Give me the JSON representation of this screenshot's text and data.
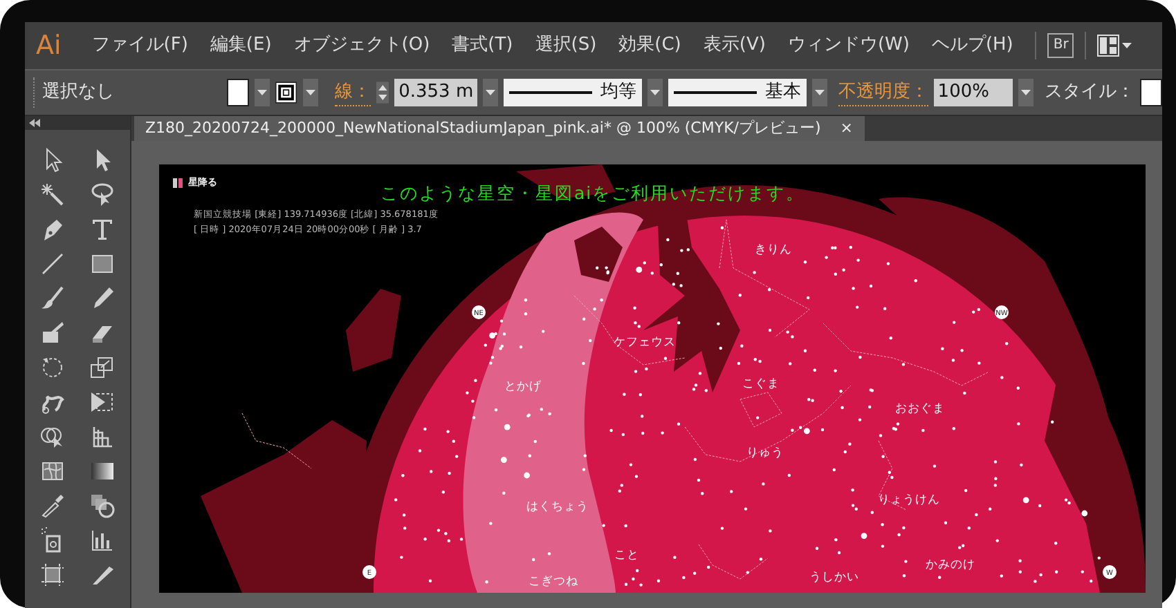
{
  "app": {
    "logo": "Ai",
    "menu": [
      "ファイル(F)",
      "編集(E)",
      "オブジェクト(O)",
      "書式(T)",
      "選択(S)",
      "効果(C)",
      "表示(V)",
      "ウィンドウ(W)",
      "ヘルプ(H)"
    ],
    "bridge_button": "Br"
  },
  "control_bar": {
    "selection": "選択なし",
    "stroke_label": "線：",
    "stroke_weight": "0.353 m",
    "profile": "均等",
    "brush": "基本",
    "opacity_label": "不透明度：",
    "opacity": "100%",
    "style_label": "スタイル："
  },
  "document_tab": {
    "title": "Z180_20200724_200000_NewNationalStadiumJapan_pink.ai* @ 100% (CMYK/プレビュー)",
    "close": "×"
  },
  "artboard": {
    "logo_text": "星降る",
    "banner": "このような星空・星図aiをご利用いただけます。",
    "info_lines": [
      "新国立競技場 [東経] 139.714936度 [北緯] 35.678181度",
      "[ 日時 ] 2020年07月24日 20時00分00秒 [ 月齢 ] 3.7"
    ],
    "chart_labels": [
      "きりん",
      "ケフェウス",
      "とかげ",
      "こぐま",
      "おおぐま",
      "りゅう",
      "はくちょう",
      "りょうけん",
      "こと",
      "うしかい",
      "かみのけ",
      "こぎつね"
    ],
    "directions": [
      "NE",
      "NW",
      "E",
      "W"
    ]
  }
}
